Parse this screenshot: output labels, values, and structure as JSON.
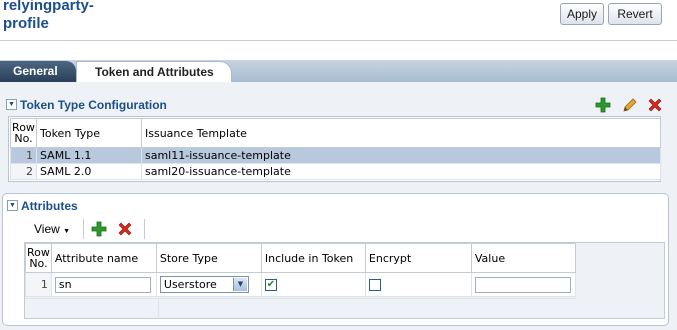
{
  "header": {
    "title": "relyingparty-profile",
    "apply_label": "Apply",
    "revert_label": "Revert"
  },
  "tabs": [
    {
      "label": "General",
      "selected": false
    },
    {
      "label": "Token and Attributes",
      "selected": true
    }
  ],
  "token_type_config": {
    "title": "Token Type Configuration",
    "toolbar_icons": [
      "add-icon",
      "edit-icon",
      "delete-icon"
    ],
    "columns": {
      "row_no": "Row No.",
      "token_type": "Token Type",
      "issuance_template": "Issuance Template"
    },
    "rows": [
      {
        "row": "1",
        "token_type": "SAML 1.1",
        "issuance_template": "saml11-issuance-template",
        "selected": true
      },
      {
        "row": "2",
        "token_type": "SAML 2.0",
        "issuance_template": "saml20-issuance-template",
        "selected": false
      }
    ]
  },
  "attributes": {
    "title": "Attributes",
    "view_label": "View",
    "toolbar_icons": [
      "add-icon",
      "delete-icon"
    ],
    "columns": {
      "row_no": "Row No.",
      "attribute_name": "Attribute name",
      "store_type": "Store Type",
      "include_in_token": "Include in Token",
      "encrypt": "Encrypt",
      "value": "Value"
    },
    "rows": [
      {
        "row": "1",
        "attribute_name": "sn",
        "store_type": "Userstore",
        "include_in_token": true,
        "encrypt": false,
        "value": ""
      }
    ]
  },
  "colors": {
    "title_blue": "#1c4f8a",
    "selected_row": "#b8c9de",
    "add_green": "#2c9a2c",
    "delete_red": "#d42a1e"
  }
}
